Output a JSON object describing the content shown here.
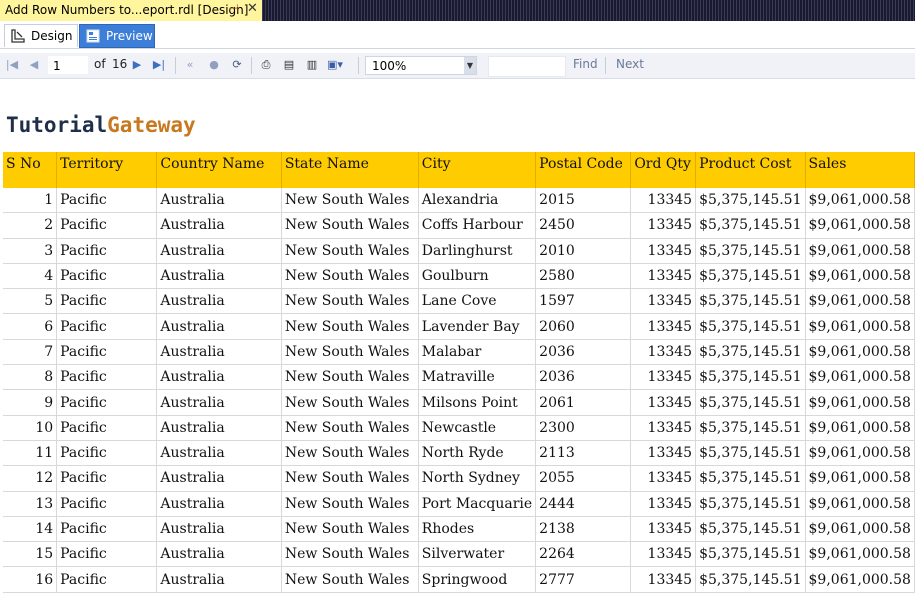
{
  "doc_tab": {
    "title": "Add Row Numbers to...eport.rdl [Design]",
    "pin": "⊣",
    "close": "✕"
  },
  "view_tabs": {
    "design": "Design",
    "preview": "Preview"
  },
  "toolbar": {
    "page_current": "1",
    "of_label": "of",
    "page_total": "16",
    "zoom": "100%",
    "find": "Find",
    "next": "Next"
  },
  "logo": {
    "part1": "Tutorial",
    "part2": "Gateway"
  },
  "table": {
    "headers": [
      "S No",
      "Territory",
      "Country Name",
      "State Name",
      "City",
      "Postal Code",
      "Ord Qty",
      "Product Cost",
      "Sales"
    ],
    "rows": [
      [
        "1",
        "Pacific",
        "Australia",
        "New South Wales",
        "Alexandria",
        "2015",
        "13345",
        "$5,375,145.51",
        "$9,061,000.58"
      ],
      [
        "2",
        "Pacific",
        "Australia",
        "New South Wales",
        "Coffs Harbour",
        "2450",
        "13345",
        "$5,375,145.51",
        "$9,061,000.58"
      ],
      [
        "3",
        "Pacific",
        "Australia",
        "New South Wales",
        "Darlinghurst",
        "2010",
        "13345",
        "$5,375,145.51",
        "$9,061,000.58"
      ],
      [
        "4",
        "Pacific",
        "Australia",
        "New South Wales",
        "Goulburn",
        "2580",
        "13345",
        "$5,375,145.51",
        "$9,061,000.58"
      ],
      [
        "5",
        "Pacific",
        "Australia",
        "New South Wales",
        "Lane Cove",
        "1597",
        "13345",
        "$5,375,145.51",
        "$9,061,000.58"
      ],
      [
        "6",
        "Pacific",
        "Australia",
        "New South Wales",
        "Lavender Bay",
        "2060",
        "13345",
        "$5,375,145.51",
        "$9,061,000.58"
      ],
      [
        "7",
        "Pacific",
        "Australia",
        "New South Wales",
        "Malabar",
        "2036",
        "13345",
        "$5,375,145.51",
        "$9,061,000.58"
      ],
      [
        "8",
        "Pacific",
        "Australia",
        "New South Wales",
        "Matraville",
        "2036",
        "13345",
        "$5,375,145.51",
        "$9,061,000.58"
      ],
      [
        "9",
        "Pacific",
        "Australia",
        "New South Wales",
        "Milsons Point",
        "2061",
        "13345",
        "$5,375,145.51",
        "$9,061,000.58"
      ],
      [
        "10",
        "Pacific",
        "Australia",
        "New South Wales",
        "Newcastle",
        "2300",
        "13345",
        "$5,375,145.51",
        "$9,061,000.58"
      ],
      [
        "11",
        "Pacific",
        "Australia",
        "New South Wales",
        "North Ryde",
        "2113",
        "13345",
        "$5,375,145.51",
        "$9,061,000.58"
      ],
      [
        "12",
        "Pacific",
        "Australia",
        "New South Wales",
        "North Sydney",
        "2055",
        "13345",
        "$5,375,145.51",
        "$9,061,000.58"
      ],
      [
        "13",
        "Pacific",
        "Australia",
        "New South Wales",
        "Port Macquarie",
        "2444",
        "13345",
        "$5,375,145.51",
        "$9,061,000.58"
      ],
      [
        "14",
        "Pacific",
        "Australia",
        "New South Wales",
        "Rhodes",
        "2138",
        "13345",
        "$5,375,145.51",
        "$9,061,000.58"
      ],
      [
        "15",
        "Pacific",
        "Australia",
        "New South Wales",
        "Silverwater",
        "2264",
        "13345",
        "$5,375,145.51",
        "$9,061,000.58"
      ],
      [
        "16",
        "Pacific",
        "Australia",
        "New South Wales",
        "Springwood",
        "2777",
        "13345",
        "$5,375,145.51",
        "$9,061,000.58"
      ]
    ]
  },
  "colors": {
    "header_bg": "#ffcc00",
    "logo_dark": "#1f2f4a",
    "logo_accent": "#c8781e",
    "preview_tab": "#3d7fd8",
    "doc_tab": "#fff59d"
  }
}
